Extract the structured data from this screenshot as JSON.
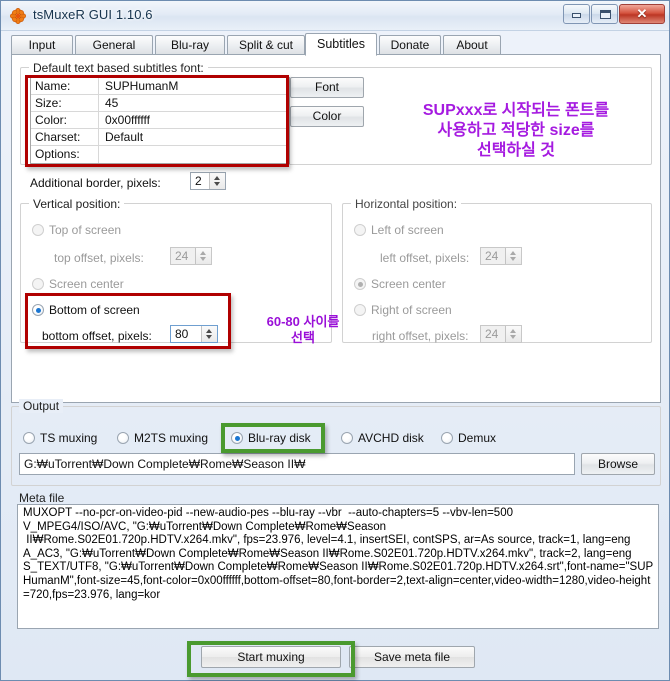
{
  "window": {
    "title": "tsMuxeR GUI 1.10.6",
    "icon": "asterisk-flower-icon",
    "controls": {
      "minimize": "minimize-icon",
      "maximize": "maximize-icon",
      "close": "✕"
    }
  },
  "tabs": [
    {
      "label": "Input",
      "active": false
    },
    {
      "label": "General",
      "active": false
    },
    {
      "label": "Blu-ray",
      "active": false
    },
    {
      "label": "Split & cut",
      "active": false
    },
    {
      "label": "Subtitles",
      "active": true
    },
    {
      "label": "Donate",
      "active": false
    },
    {
      "label": "About",
      "active": false
    }
  ],
  "subtitles": {
    "font_group_title": "Default text based subtitles font:",
    "font_rows": [
      {
        "key": "Name:",
        "value": "SUPHumanM"
      },
      {
        "key": "Size:",
        "value": "45"
      },
      {
        "key": "Color:",
        "value": "0x00ffffff"
      },
      {
        "key": "Charset:",
        "value": "Default"
      },
      {
        "key": "Options:",
        "value": ""
      }
    ],
    "font_button": "Font",
    "color_button": "Color",
    "additional_border_label": "Additional border, pixels:",
    "additional_border_value": "2",
    "vertical": {
      "title": "Vertical position:",
      "options": [
        {
          "label": "Top of screen",
          "selected": false,
          "disabled": true
        },
        {
          "label": "Screen center",
          "selected": false,
          "disabled": true
        },
        {
          "label": "Bottom of screen",
          "selected": true,
          "disabled": false
        }
      ],
      "top_offset_label": "top offset, pixels:",
      "top_offset_value": "24",
      "bottom_offset_label": "bottom offset, pixels:",
      "bottom_offset_value": "80"
    },
    "horizontal": {
      "title": "Horizontal position:",
      "options": [
        {
          "label": "Left of screen",
          "selected": false,
          "disabled": true
        },
        {
          "label": "Screen center",
          "selected": true,
          "disabled": true
        },
        {
          "label": "Right of screen",
          "selected": false,
          "disabled": true
        }
      ],
      "left_offset_label": "left offset, pixels:",
      "left_offset_value": "24",
      "right_offset_label": "right offset, pixels:",
      "right_offset_value": "24"
    }
  },
  "output": {
    "group_title": "Output",
    "modes": [
      {
        "label": "TS muxing",
        "selected": false
      },
      {
        "label": "M2TS muxing",
        "selected": false
      },
      {
        "label": "Blu-ray disk",
        "selected": true
      },
      {
        "label": "AVCHD disk",
        "selected": false
      },
      {
        "label": "Demux",
        "selected": false
      }
    ],
    "path_value": "G:₩uTorrent₩Down Complete₩Rome₩Season II₩",
    "browse_button": "Browse"
  },
  "meta": {
    "title": "Meta file",
    "text": "MUXOPT --no-pcr-on-video-pid --new-audio-pes --blu-ray --vbr  --auto-chapters=5 --vbv-len=500\nV_MPEG4/ISO/AVC, \"G:₩uTorrent₩Down Complete₩Rome₩Season\n II₩Rome.S02E01.720p.HDTV.x264.mkv\", fps=23.976, level=4.1, insertSEI, contSPS, ar=As source, track=1, lang=eng\nA_AC3, \"G:₩uTorrent₩Down Complete₩Rome₩Season II₩Rome.S02E01.720p.HDTV.x264.mkv\", track=2, lang=eng\nS_TEXT/UTF8, \"G:₩uTorrent₩Down Complete₩Rome₩Season II₩Rome.S02E01.720p.HDTV.x264.srt\",font-name=\"SUPHumanM\",font-size=45,font-color=0x00ffffff,bottom-offset=80,font-border=2,text-align=center,video-width=1280,video-height=720,fps=23.976, lang=kor"
  },
  "footer": {
    "start_button": "Start muxing",
    "save_button": "Save meta file"
  },
  "annotations": [
    {
      "name": "font-annotation",
      "text": "SUPxxx로 시작되는 폰트를\n사용하고 적당한 size를\n선택하실 것",
      "color": "#a51ae0"
    },
    {
      "name": "offset-annotation",
      "text": "60-80 사이를\n선택",
      "color": "#9a10d8"
    }
  ],
  "highlight_colors": {
    "red": "#b00000",
    "green": "#4a9a2f"
  }
}
